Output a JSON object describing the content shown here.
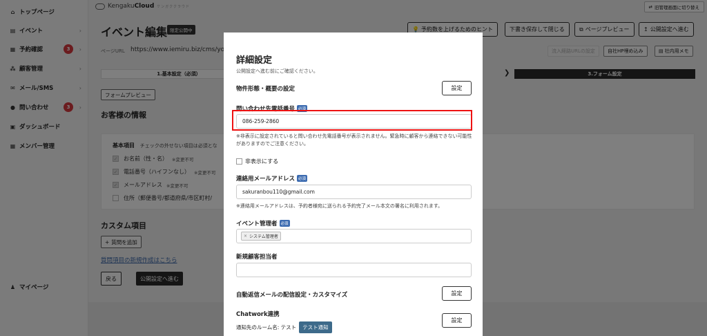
{
  "sidebar": {
    "items": [
      {
        "label": "トップページ",
        "icon": "home-icon",
        "glyph": "⌂"
      },
      {
        "label": "イベント",
        "icon": "document-icon",
        "glyph": "▤",
        "chevron": "›"
      },
      {
        "label": "予約確認",
        "icon": "calendar-icon",
        "glyph": "▦",
        "badge": "3",
        "chevron": "›"
      },
      {
        "label": "顧客管理",
        "icon": "users-icon",
        "glyph": "⁂",
        "chevron": "›"
      },
      {
        "label": "メール/SMS",
        "icon": "mail-icon",
        "glyph": "✉",
        "chevron": "›"
      },
      {
        "label": "問い合わせ",
        "icon": "chat-icon",
        "glyph": "●",
        "badge": "3",
        "chevron": "›"
      },
      {
        "label": "ダッシュボード",
        "icon": "dashboard-icon",
        "glyph": "▣"
      },
      {
        "label": "メンバー管理",
        "icon": "grid-icon",
        "glyph": "▦"
      },
      {
        "label": "マイページ",
        "icon": "user-icon",
        "glyph": "♟"
      }
    ]
  },
  "topbar": {
    "brand_prefix": "Kengaku",
    "brand_name": "Cloud",
    "brand_tagline": "ケンガククラウド",
    "switch_label": "旧管理画面に切り替え"
  },
  "page": {
    "title": "イベント編集",
    "draft_tag": "限定公開中",
    "hint_button": "予約数を上げるためのヒント",
    "save_draft_button": "下書き保存して閉じる",
    "preview_button": "ページプレビュー",
    "publish_button": "公開設定へ進む",
    "url_label": "ページURL",
    "url_value": "https://www.iemiru.biz/cms/yoy",
    "url_copy_button": "流入経路URLの設定",
    "embed_button": "自社HP埋め込み",
    "memo_button": "社内用メモ"
  },
  "steps": {
    "step1": "1.基本設定（必須）",
    "arrow": "❯",
    "step3": "3.フォーム設定"
  },
  "form": {
    "preview_button": "フォームプレビュー",
    "customer_info_title": "お客様の情報",
    "basic_items_title": "基本項目",
    "basic_items_note": "チェックの外せない項目は必須とな",
    "basic_items": [
      {
        "label": "お名前（性・名）",
        "note": "※変更不可",
        "checked": true
      },
      {
        "label": "電話番号（ハイフンなし）",
        "note": "※変更不可",
        "checked": true
      },
      {
        "label": "メールアドレス",
        "note": "※変更不可",
        "checked": true
      },
      {
        "label": "住所（郵便番号/都道府県/市区町村/",
        "note": "",
        "checked": false
      }
    ],
    "custom_items_title": "カスタム項目",
    "add_question_button": "質問を追加",
    "new_question_link": "質問項目の新規作成はこちら",
    "back_button": "戻る",
    "next_button": "公開設定へ進む"
  },
  "modal": {
    "title": "詳細設定",
    "subtitle": "公開設定へ進む前にご確認ください。",
    "property_label": "物件形態・概要の設定",
    "settings_button": "設定",
    "phone_label": "問い合わせ先電話番号",
    "required_badge": "必須",
    "phone_value": "086-259-2860",
    "phone_note": "※非表示に設定されていると問い合わせ先電話番号が表示されません。緊急時に顧客から連絡できない可能性がありますのでご注意ください。",
    "hide_label": "非表示にする",
    "email_label": "連絡用メールアドレス",
    "email_value": "sakuranbou110@gmail.com",
    "email_note": "※連絡用メールアドレスは、予約者様宛に送られる予約完了メール本文の署名に利用されます。",
    "manager_label": "イベント管理者",
    "manager_tag": "システム管理者",
    "manager_tag_remove": "×",
    "new_customer_label": "新規顧客担当者",
    "new_customer_value": "",
    "auto_mail_label": "自動返信メールの配信設定・カスタマイズ",
    "chatwork_label": "Chatwork連携",
    "chatwork_room": "通知先のルーム名: テスト",
    "test_notify_button": "テスト通知"
  }
}
